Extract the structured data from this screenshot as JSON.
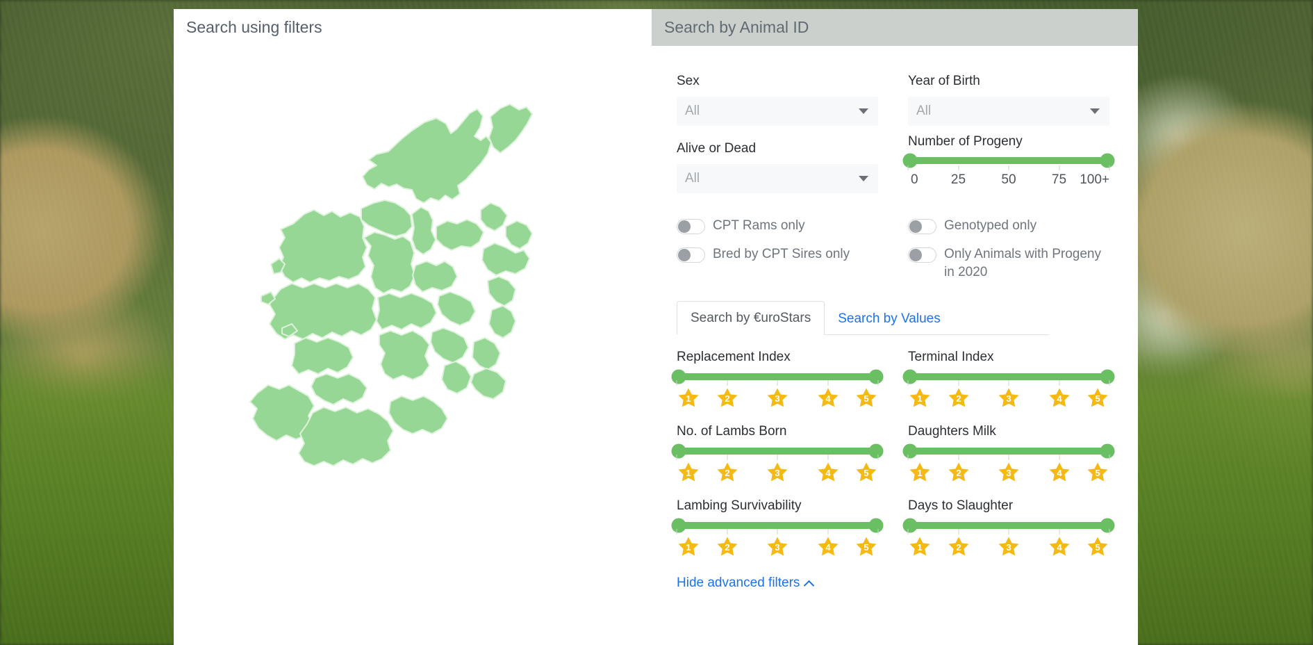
{
  "window": {
    "background_description": "sheep-in-grass-photo"
  },
  "tabs": {
    "active_label": "Search using filters",
    "inactive_label": "Search by Animal ID"
  },
  "map": {
    "name": "ireland-counties-map",
    "fill_color": "#97d795",
    "border_color": "#d9f0d6"
  },
  "filters": {
    "sex": {
      "label": "Sex",
      "value": "All"
    },
    "alive_or_dead": {
      "label": "Alive or Dead",
      "value": "All"
    },
    "year_of_birth": {
      "label": "Year of Birth",
      "value": "All"
    },
    "number_of_progeny": {
      "label": "Number of Progeny",
      "ticks": [
        "0",
        "25",
        "50",
        "75",
        "100+"
      ],
      "min": 0,
      "max": 100,
      "selected_min": 0,
      "selected_max": 100
    },
    "toggles_left": [
      {
        "label": "CPT Rams only",
        "on": false
      },
      {
        "label": "Bred by CPT Sires only",
        "on": false
      }
    ],
    "toggles_right": [
      {
        "label": "Genotyped only",
        "on": false
      },
      {
        "label": "Only Animals with Progeny in 2020",
        "on": false
      }
    ]
  },
  "inner_tabs": {
    "active": "Search by €uroStars",
    "inactive": "Search by Values"
  },
  "star_sliders": [
    {
      "label": "Replacement Index",
      "stars": [
        "1",
        "2",
        "3",
        "4",
        "5"
      ],
      "selected_min": 1,
      "selected_max": 5
    },
    {
      "label": "Terminal Index",
      "stars": [
        "1",
        "2",
        "3",
        "4",
        "5"
      ],
      "selected_min": 1,
      "selected_max": 5
    },
    {
      "label": "No. of Lambs Born",
      "stars": [
        "1",
        "2",
        "3",
        "4",
        "5"
      ],
      "selected_min": 1,
      "selected_max": 5
    },
    {
      "label": "Daughters Milk",
      "stars": [
        "1",
        "2",
        "3",
        "4",
        "5"
      ],
      "selected_min": 1,
      "selected_max": 5
    },
    {
      "label": "Lambing Survivability",
      "stars": [
        "1",
        "2",
        "3",
        "4",
        "5"
      ],
      "selected_min": 1,
      "selected_max": 5
    },
    {
      "label": "Days to Slaughter",
      "stars": [
        "1",
        "2",
        "3",
        "4",
        "5"
      ],
      "selected_min": 1,
      "selected_max": 5
    }
  ],
  "footer": {
    "hide_advanced_filters": "Hide advanced filters"
  },
  "colors": {
    "slider_green": "#6abf63",
    "star_gold": "#f5b914",
    "link_blue": "#1a73e8",
    "map_green": "#97d795"
  }
}
